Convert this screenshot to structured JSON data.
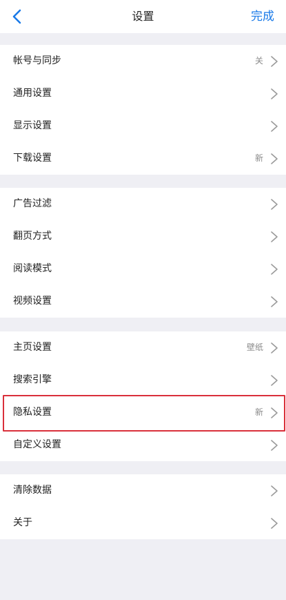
{
  "header": {
    "title": "设置",
    "done_label": "完成",
    "back_icon": "chevron-left-icon"
  },
  "groups": [
    {
      "items": [
        {
          "label": "帐号与同步",
          "value": "关"
        },
        {
          "label": "通用设置",
          "value": ""
        },
        {
          "label": "显示设置",
          "value": ""
        },
        {
          "label": "下载设置",
          "value": "新"
        }
      ]
    },
    {
      "items": [
        {
          "label": "广告过滤",
          "value": ""
        },
        {
          "label": "翻页方式",
          "value": ""
        },
        {
          "label": "阅读模式",
          "value": ""
        },
        {
          "label": "视频设置",
          "value": ""
        }
      ]
    },
    {
      "items": [
        {
          "label": "主页设置",
          "value": "壁纸"
        },
        {
          "label": "搜索引擎",
          "value": ""
        },
        {
          "label": "隐私设置",
          "value": "新",
          "highlighted": true
        },
        {
          "label": "自定义设置",
          "value": ""
        }
      ]
    },
    {
      "items": [
        {
          "label": "清除数据",
          "value": ""
        },
        {
          "label": "关于",
          "value": ""
        }
      ]
    }
  ],
  "colors": {
    "accent": "#1a7ae8",
    "background": "#efeff4",
    "highlight_border": "#d92f3a",
    "secondary_text": "#8a8a8a"
  }
}
